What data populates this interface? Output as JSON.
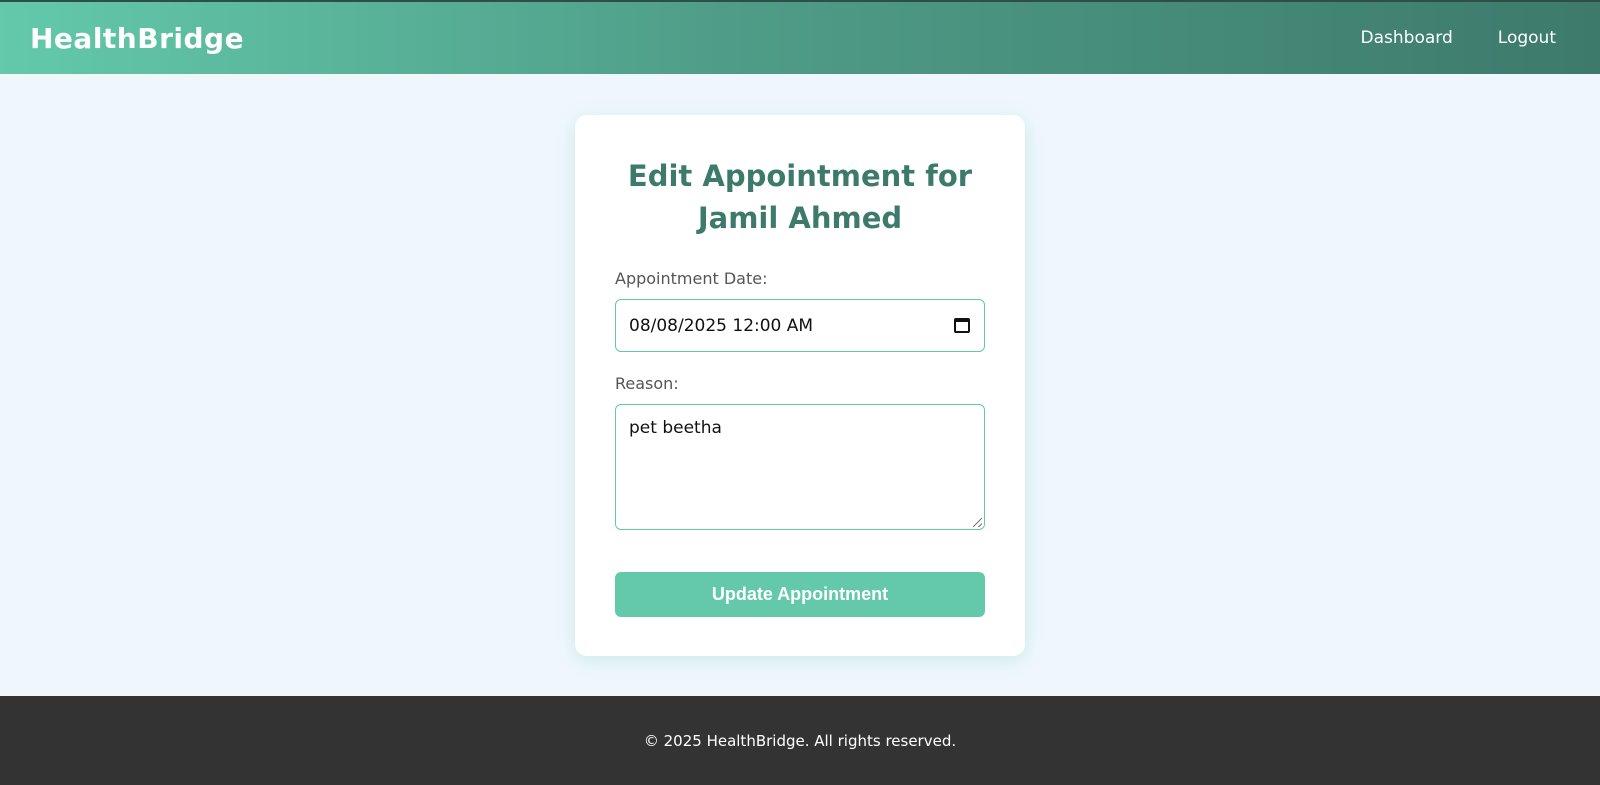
{
  "navbar": {
    "brand": "HealthBridge",
    "links": [
      {
        "label": "Dashboard"
      },
      {
        "label": "Logout"
      }
    ]
  },
  "form": {
    "title_line1": "Edit Appointment for",
    "title_line2": "Jamil Ahmed",
    "date_label": "Appointment Date:",
    "date_value": "08/08/2025 12:00 AM",
    "reason_label": "Reason:",
    "reason_value": "pet beetha",
    "submit_label": "Update Appointment"
  },
  "footer": {
    "text": "© 2025 HealthBridge. All rights reserved."
  },
  "icons": {
    "date_picker": "calendar-icon",
    "textarea_resize": "resize-handle-icon"
  },
  "colors": {
    "accent": "#63c9aa",
    "accent_dark": "#3d7a6c",
    "page_bg": "#eff7fd",
    "footer_bg": "#333333"
  }
}
